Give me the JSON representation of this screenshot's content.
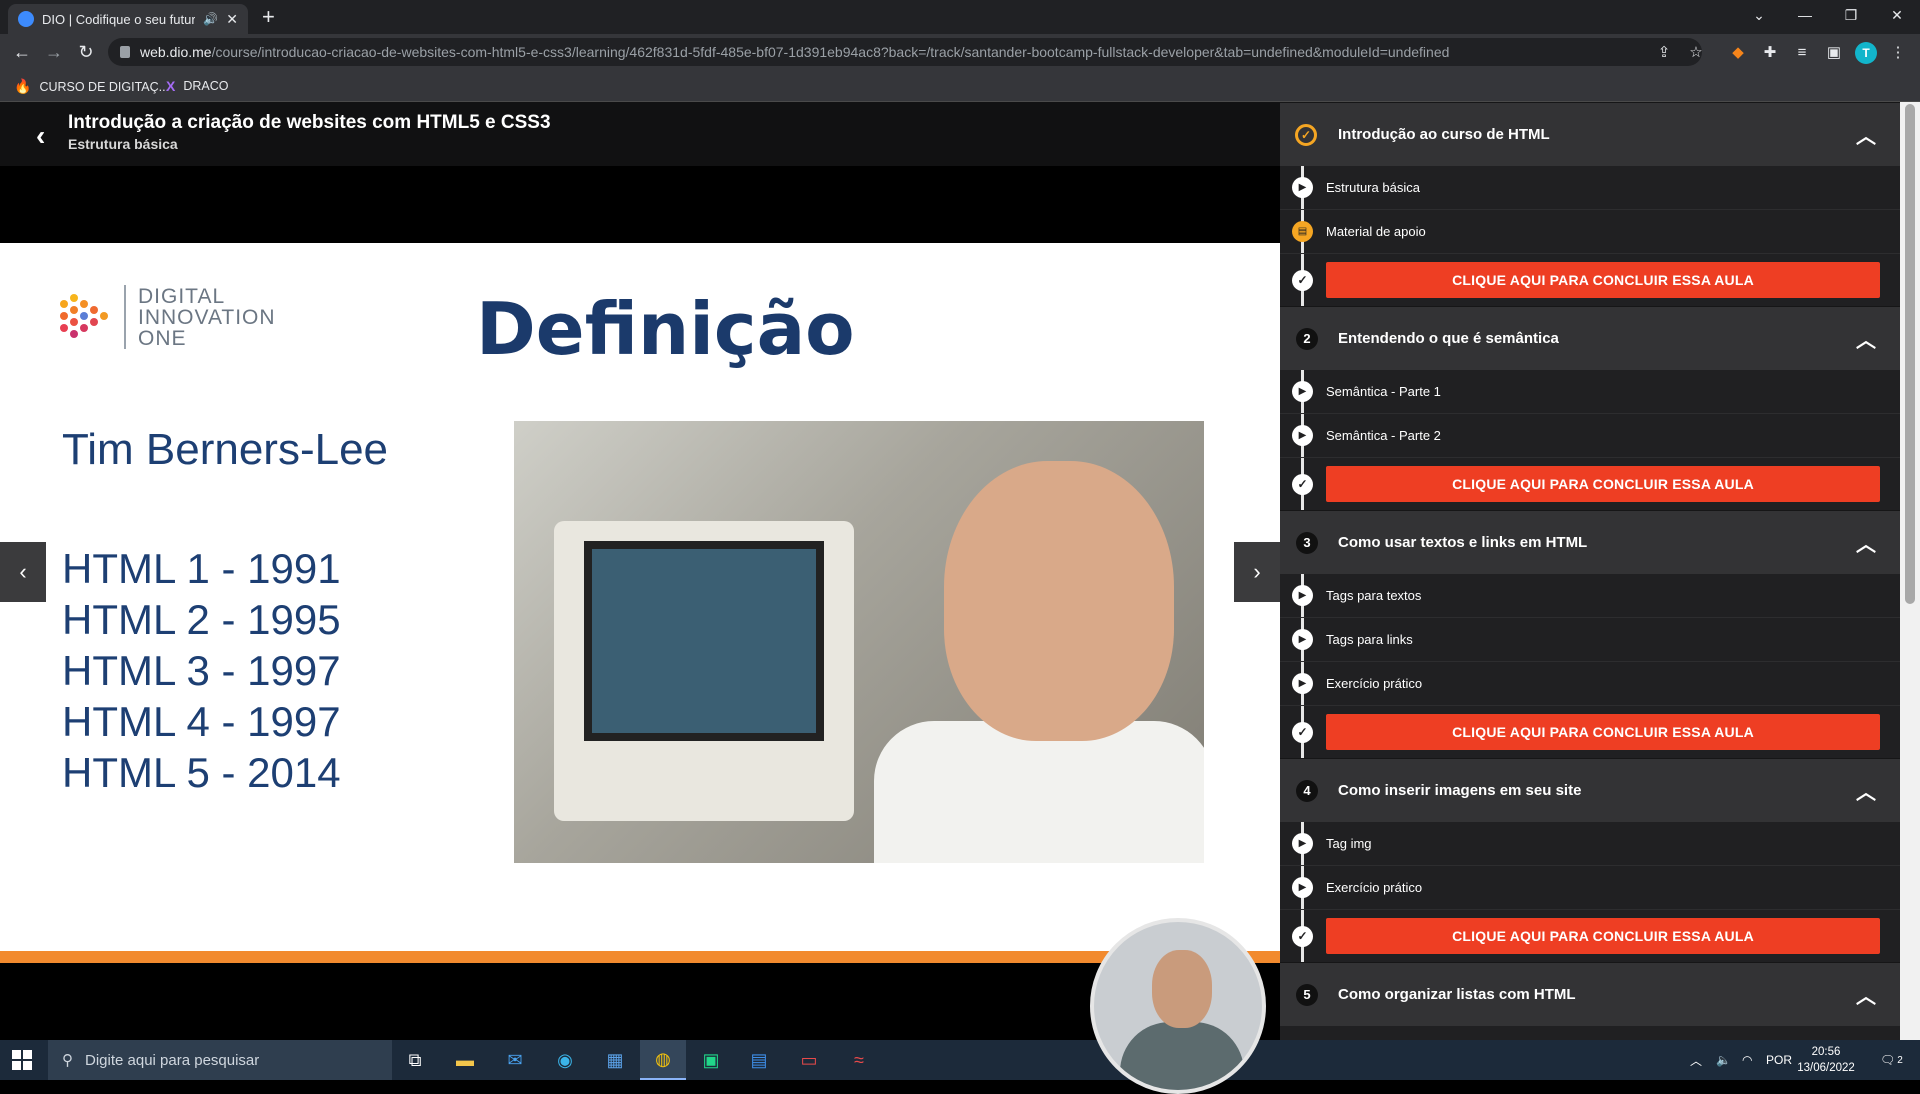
{
  "browser": {
    "tab_title": "DIO | Codifique o seu futuro",
    "url_host": "web.dio.me",
    "url_path": "/course/introducao-criacao-de-websites-com-html5-e-css3/learning/462f831d-5fdf-485e-bf07-1d391eb94ac8?back=/track/santander-bootcamp-fullstack-developer&tab=undefined&moduleId=undefined",
    "avatar_letter": "T",
    "bookmarks": [
      {
        "label": "CURSO DE DIGITAÇ...",
        "icon": "flame-icon"
      },
      {
        "label": "DRACO",
        "icon": "x-logo-icon"
      }
    ]
  },
  "course": {
    "title": "Introdução a criação de websites com HTML5 e CSS3",
    "current_lesson": "Estrutura básica"
  },
  "slide": {
    "logo_lines": [
      "DIGITAL",
      "INNOVATION",
      "ONE"
    ],
    "heading": "Definição",
    "person": "Tim Berners-Lee",
    "versions": [
      "HTML 1 - 1991",
      "HTML 2 - 1995",
      "HTML 3 - 1997",
      "HTML 4 - 1997",
      "HTML 5 - 2014"
    ]
  },
  "sidebar": {
    "finish_label": "CLIQUE AQUI PARA CONCLUIR ESSA AULA",
    "modules": [
      {
        "num": "",
        "completed": true,
        "title": "Introdução ao curso de HTML",
        "lessons": [
          "Estrutura básica",
          "Material de apoio"
        ]
      },
      {
        "num": "2",
        "completed": false,
        "title": "Entendendo o que é semântica",
        "lessons": [
          "Semântica - Parte 1",
          "Semântica - Parte 2"
        ]
      },
      {
        "num": "3",
        "completed": false,
        "title": "Como usar textos e links em HTML",
        "lessons": [
          "Tags para textos",
          "Tags para links",
          "Exercício prático"
        ]
      },
      {
        "num": "4",
        "completed": false,
        "title": "Como inserir imagens em seu site",
        "lessons": [
          "Tag img",
          "Exercício prático"
        ]
      },
      {
        "num": "5",
        "completed": false,
        "title": "Como organizar listas com HTML",
        "lessons": []
      }
    ]
  },
  "taskbar": {
    "search_placeholder": "Digite aqui para pesquisar",
    "language": "POR",
    "time": "20:56",
    "date": "13/06/2022",
    "notifications": "2"
  },
  "colors": {
    "accent_orange": "#f5a623",
    "finish_red": "#ee3e23",
    "slide_blue": "#1b3a6b"
  }
}
